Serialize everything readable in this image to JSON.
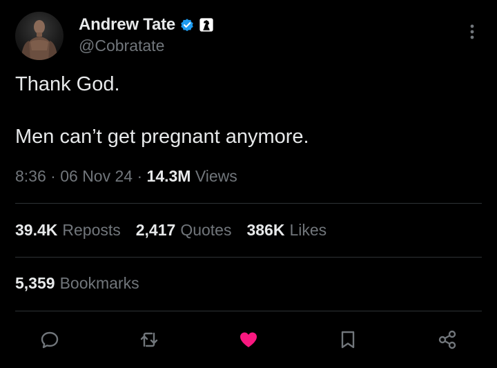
{
  "author": {
    "display_name": "Andrew Tate",
    "handle": "@Cobratate"
  },
  "tweet": {
    "line1": "Thank God.",
    "line2": "Men can’t get pregnant anymore."
  },
  "meta": {
    "time": "8:36",
    "date": "06 Nov 24",
    "separator": "·",
    "views_count": "14.3M",
    "views_label": "Views"
  },
  "stats": {
    "reposts_count": "39.4K",
    "reposts_label": "Reposts",
    "quotes_count": "2,417",
    "quotes_label": "Quotes",
    "likes_count": "386K",
    "likes_label": "Likes",
    "bookmarks_count": "5,359",
    "bookmarks_label": "Bookmarks"
  },
  "icons": {
    "verified": "verified-badge-icon",
    "affiliate": "chess-knight-icon",
    "more": "more-vertical-icon",
    "reply": "reply-icon",
    "repost": "repost-icon",
    "like": "heart-icon",
    "bookmark": "bookmark-icon",
    "share": "share-icon"
  },
  "colors": {
    "background": "#000000",
    "text_primary": "#e7e9ea",
    "text_secondary": "#71767b",
    "verified_blue": "#1d9bf0",
    "like_pink": "#f91880",
    "divider": "#2f3336"
  }
}
